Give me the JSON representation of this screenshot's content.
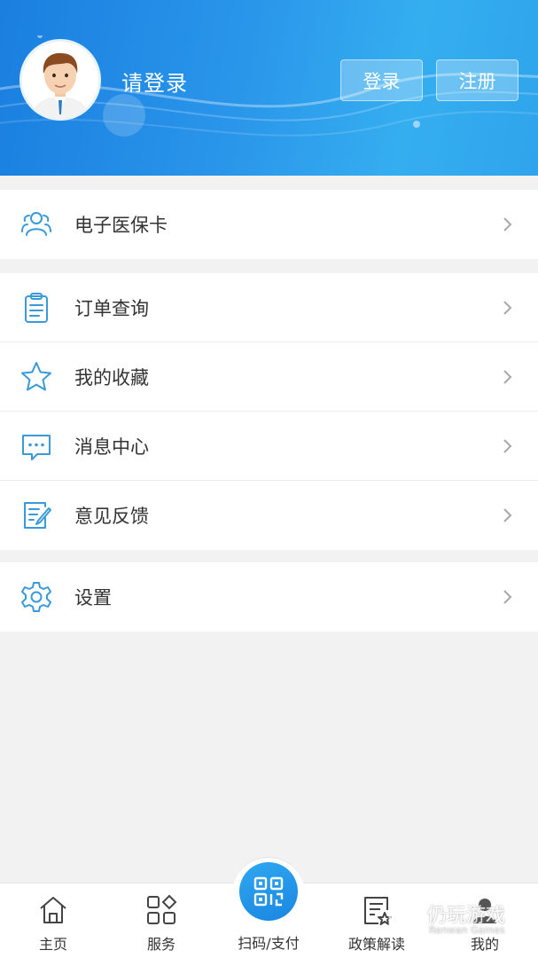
{
  "header": {
    "login_prompt": "请登录",
    "login_button": "登录",
    "register_button": "注册"
  },
  "menu_groups": [
    [
      {
        "label": "电子医保卡",
        "icon": "people-icon"
      }
    ],
    [
      {
        "label": "订单查询",
        "icon": "clipboard-icon"
      },
      {
        "label": "我的收藏",
        "icon": "star-icon"
      },
      {
        "label": "消息中心",
        "icon": "message-icon"
      },
      {
        "label": "意见反馈",
        "icon": "feedback-icon"
      }
    ],
    [
      {
        "label": "设置",
        "icon": "gear-icon"
      }
    ]
  ],
  "tabbar": {
    "tabs": [
      {
        "label": "主页",
        "icon": "home-icon"
      },
      {
        "label": "服务",
        "icon": "grid-icon"
      },
      {
        "label": "扫码/支付",
        "icon": "qrcode-icon"
      },
      {
        "label": "政策解读",
        "icon": "document-star-icon"
      },
      {
        "label": "我的",
        "icon": "person-icon",
        "active": true
      }
    ]
  },
  "watermark": {
    "text": "仍玩游戏",
    "subtext": "Renwan Games"
  },
  "colors": {
    "accent": "#2a96ea",
    "icon_blue": "#3a9ad9"
  }
}
